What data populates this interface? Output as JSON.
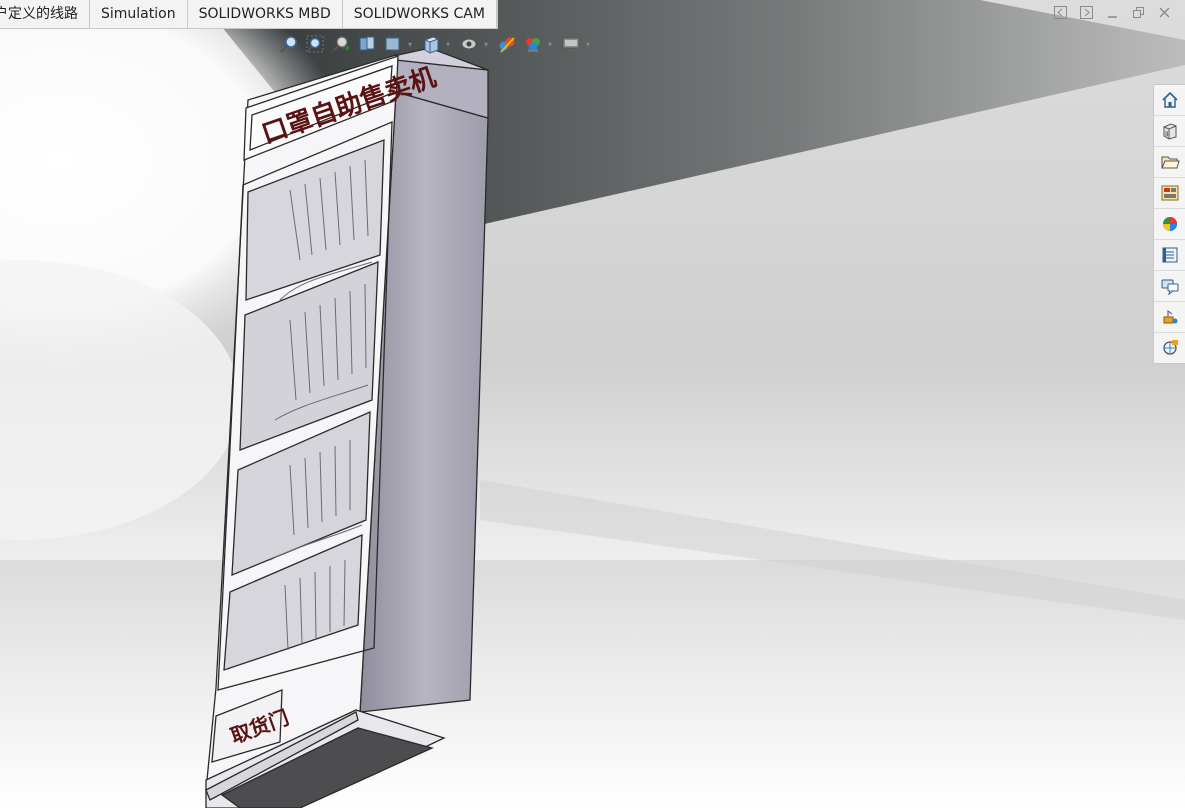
{
  "tabs": [
    {
      "label": "户定义的线路",
      "active": false
    },
    {
      "label": "Simulation",
      "active": false
    },
    {
      "label": "SOLIDWORKS MBD",
      "active": false
    },
    {
      "label": "SOLIDWORKS CAM",
      "active": false
    }
  ],
  "window_controls": [
    "tile-left-icon",
    "tile-right-icon",
    "minimize-icon",
    "restore-icon",
    "close-icon"
  ],
  "hud_toolbar": [
    "zoom-to-fit-icon",
    "zoom-to-area-icon",
    "previous-view-icon",
    "section-view-icon",
    "dynamic-annotation-icon",
    "view-orientation-icon",
    "display-style-icon",
    "hide-show-icon",
    "edit-appearance-icon",
    "apply-scene-icon",
    "view-settings-icon"
  ],
  "task_pane": [
    "home-icon",
    "3d-part-icon",
    "folder-icon",
    "view-palette-icon",
    "appearances-icon",
    "custom-properties-icon",
    "forum-icon",
    "electrical-icon",
    "plastics-icon"
  ],
  "model": {
    "top_sign": "口罩自助售卖机",
    "pickup_sign": "取货门",
    "body_color": "#a8a6b4",
    "sign_color": "#5a1212"
  }
}
